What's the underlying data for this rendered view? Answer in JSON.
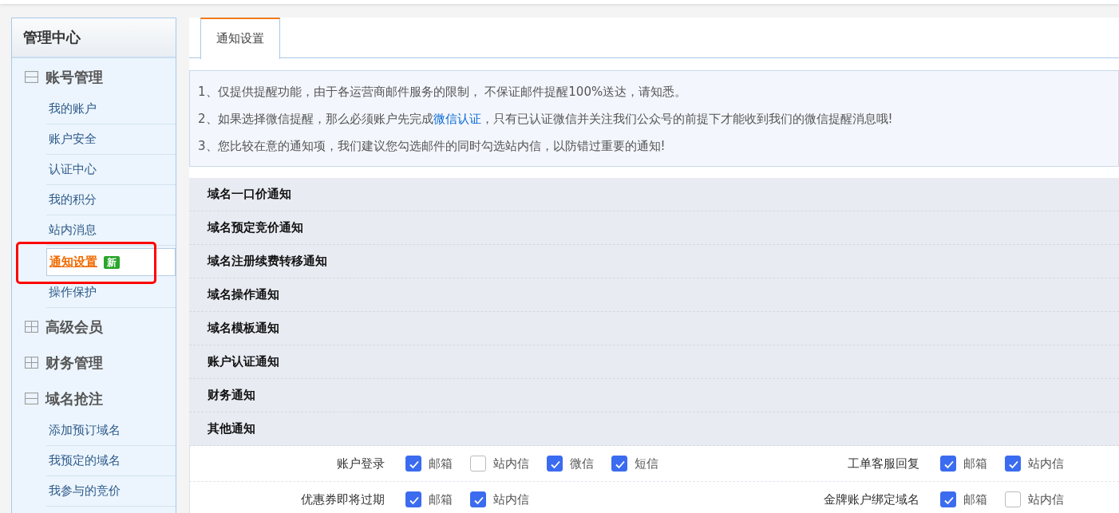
{
  "sidebar": {
    "title": "管理中心",
    "groups": [
      {
        "label": "账号管理",
        "expanded": true,
        "items": [
          {
            "label": "我的账户",
            "selected": false
          },
          {
            "label": "账户安全",
            "selected": false
          },
          {
            "label": "认证中心",
            "selected": false
          },
          {
            "label": "我的积分",
            "selected": false
          },
          {
            "label": "站内消息",
            "selected": false
          },
          {
            "label": "通知设置",
            "selected": true,
            "badge": "新",
            "highlighted": true
          },
          {
            "label": "操作保护",
            "selected": false
          }
        ]
      },
      {
        "label": "高级会员",
        "expanded": false
      },
      {
        "label": "财务管理",
        "expanded": false
      },
      {
        "label": "域名抢注",
        "expanded": true,
        "items": [
          {
            "label": "添加预订域名",
            "selected": false
          },
          {
            "label": "我预定的域名",
            "selected": false
          },
          {
            "label": "我参与的竞价",
            "selected": false
          }
        ]
      }
    ]
  },
  "tabs": [
    {
      "label": "通知设置",
      "selected": true
    }
  ],
  "notices": [
    {
      "parts": [
        {
          "kind": "text",
          "text": "1、仅提供提醒功能，由于各运营商邮件服务的限制， 不保证邮件提醒100%送达，请知悉。"
        }
      ]
    },
    {
      "parts": [
        {
          "kind": "text",
          "text": "2、如果选择微信提醒，那么必须账户先完成"
        },
        {
          "kind": "link",
          "text": "微信认证"
        },
        {
          "kind": "text",
          "text": "，只有已认证微信并关注我们公众号的前提下才能收到我们的微信提醒消息哦!"
        }
      ]
    },
    {
      "parts": [
        {
          "kind": "text",
          "text": "3、您比较在意的通知项，我们建议您勾选邮件的同时勾选站内信，以防错过重要的通知!"
        }
      ]
    }
  ],
  "sections": [
    {
      "title": "域名一口价通知"
    },
    {
      "title": "域名预定竞价通知"
    },
    {
      "title": "域名注册续费转移通知"
    },
    {
      "title": "域名操作通知"
    },
    {
      "title": "域名模板通知"
    },
    {
      "title": "账户认证通知"
    },
    {
      "title": "财务通知"
    },
    {
      "title": "其他通知",
      "rows": [
        {
          "cells": [
            {
              "label": "账户登录",
              "options": [
                {
                  "label": "邮箱",
                  "checked": true
                },
                {
                  "label": "站内信",
                  "checked": false
                },
                {
                  "label": "微信",
                  "checked": true
                },
                {
                  "label": "短信",
                  "checked": true
                }
              ]
            },
            {
              "label": "工单客服回复",
              "options": [
                {
                  "label": "邮箱",
                  "checked": true
                },
                {
                  "label": "站内信",
                  "checked": true
                }
              ]
            }
          ]
        },
        {
          "cells": [
            {
              "label": "优惠券即将过期",
              "options": [
                {
                  "label": "邮箱",
                  "checked": true
                },
                {
                  "label": "站内信",
                  "checked": true
                }
              ]
            },
            {
              "label": "金牌账户绑定域名",
              "options": [
                {
                  "label": "邮箱",
                  "checked": true
                },
                {
                  "label": "站内信",
                  "checked": false
                }
              ]
            }
          ]
        }
      ]
    }
  ]
}
